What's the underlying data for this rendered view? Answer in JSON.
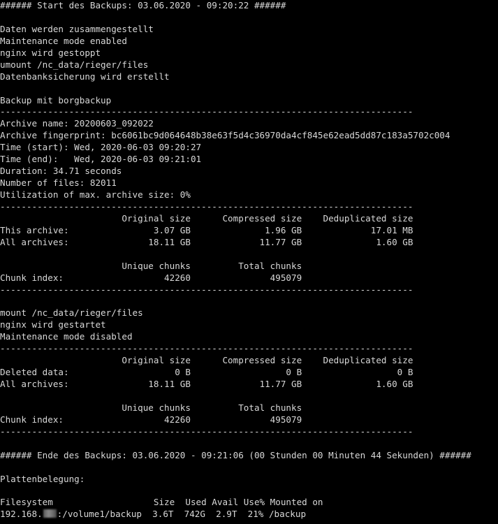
{
  "terminal": {
    "header_start": "###### Start des Backups: 03.06.2020 - 09:20:22 ######",
    "steps_1": [
      "Daten werden zusammengestellt",
      "Maintenance mode enabled",
      "nginx wird gestoppt",
      "umount /nc_data/rieger/files",
      "Datenbanksicherung wird erstellt"
    ],
    "backup_title": "Backup mit borgbackup",
    "separator": "------------------------------------------------------------------------------",
    "archive_info": [
      "Archive name: 20200603_092022",
      "Archive fingerprint: bc6061bc9d064648b38e63f5d4c36970da4cf845e62ead5dd87c183a5702c004",
      "Time (start): Wed, 2020-06-03 09:20:27",
      "Time (end):   Wed, 2020-06-03 09:21:01",
      "Duration: 34.71 seconds",
      "Number of files: 82011",
      "Utilization of max. archive size: 0%"
    ],
    "stats_1": {
      "header": "                       Original size      Compressed size    Deduplicated size",
      "rows": [
        "This archive:                3.07 GB              1.96 GB             17.01 MB",
        "All archives:               18.11 GB             11.77 GB              1.60 GB"
      ],
      "chunks_header": "                       Unique chunks         Total chunks",
      "chunks_row": "Chunk index:                   42260               495079"
    },
    "steps_2": [
      "mount /nc_data/rieger/files",
      "nginx wird gestartet",
      "Maintenance mode disabled"
    ],
    "stats_2": {
      "header": "                       Original size      Compressed size    Deduplicated size",
      "rows": [
        "Deleted data:                    0 B                  0 B                  0 B",
        "All archives:               18.11 GB             11.77 GB              1.60 GB"
      ],
      "chunks_header": "                       Unique chunks         Total chunks",
      "chunks_row": "Chunk index:                   42260               495079"
    },
    "header_end": "###### Ende des Backups: 03.06.2020 - 09:21:06 (00 Stunden 00 Minuten 44 Sekunden) ######",
    "disk_title": "Plattenbelegung:",
    "df_header": "Filesystem                   Size  Used Avail Use% Mounted on",
    "df_row_prefix": "192.168.",
    "df_row_suffix": ":/volume1/backup  3.6T  742G  2.9T  21% /backup",
    "df_row_cut": "    ...                                ..."
  }
}
